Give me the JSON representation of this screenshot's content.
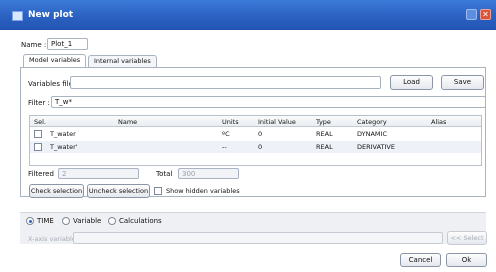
{
  "window": {
    "title": "New plot"
  },
  "name_field": {
    "label": "Name :",
    "value": "Plot_1"
  },
  "tabs": [
    {
      "label": "Model variables"
    },
    {
      "label": "Internal variables"
    }
  ],
  "variables_file": {
    "label": "Variables file:",
    "value": "",
    "load": "Load",
    "save": "Save"
  },
  "filter": {
    "label": "Filter :",
    "value": "T_w*"
  },
  "table": {
    "headers": [
      "Sel.",
      "Name",
      "Units",
      "Initial Value",
      "Type",
      "Category",
      "Alias"
    ],
    "rows": [
      {
        "name": "T_water",
        "units": "ºC",
        "initial": "0",
        "type": "REAL",
        "category": "DYNAMIC",
        "alias": ""
      },
      {
        "name": "T_water'",
        "units": "--",
        "initial": "0",
        "type": "REAL",
        "category": "DERIVATIVE",
        "alias": ""
      }
    ]
  },
  "filtered": {
    "label": "Filtered",
    "value": "2"
  },
  "total": {
    "label": "Total",
    "value": "300"
  },
  "actions": {
    "check": "Check selection",
    "uncheck": "Uncheck selection",
    "show_hidden": "Show hidden variables"
  },
  "x_axis": {
    "options": [
      "TIME",
      "Variable",
      "Calculations"
    ],
    "selected": "TIME",
    "x_axis_label": "X-axis variable",
    "select_button": "<< Select"
  },
  "footer": {
    "cancel": "Cancel",
    "ok": "Ok"
  }
}
